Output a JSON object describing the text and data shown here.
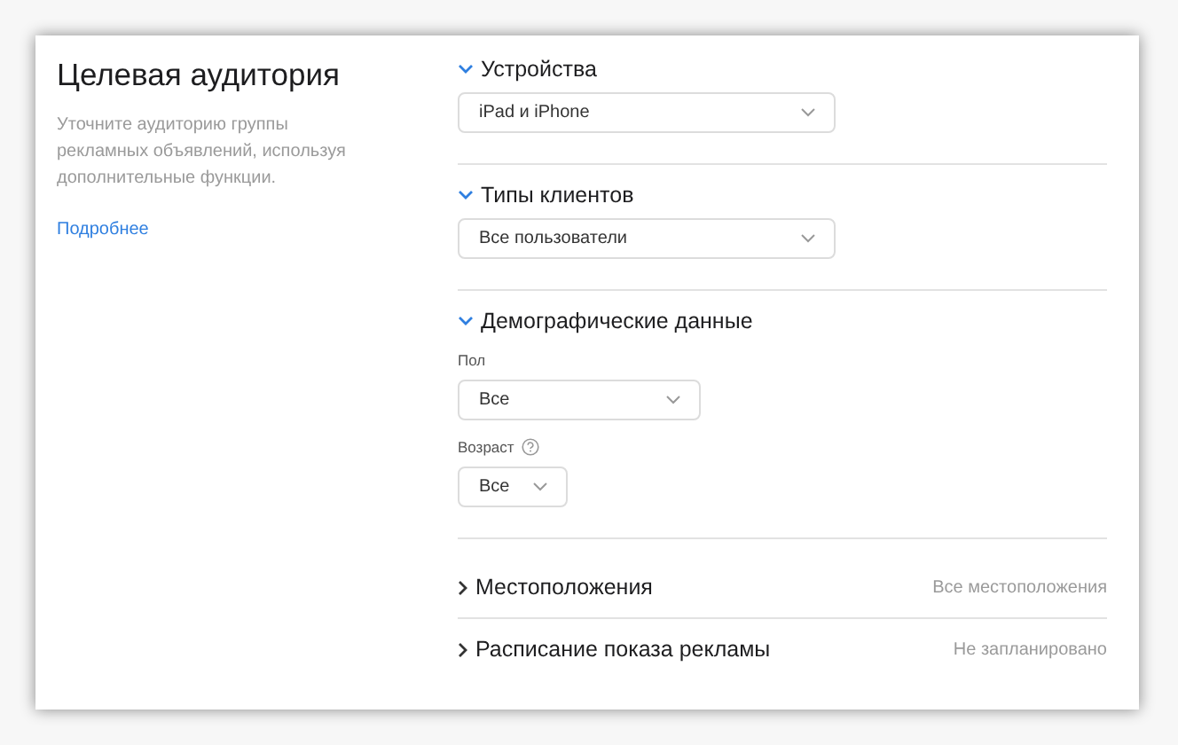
{
  "intro": {
    "title": "Целевая аудитория",
    "description": "Уточните аудиторию группы рекламных объявлений, используя дополнительные функции.",
    "link": "Подробнее"
  },
  "sections": [
    {
      "title": "Устройства",
      "expanded": true,
      "fields": [
        {
          "value": "iPad и iPhone",
          "kind": "wide"
        }
      ]
    },
    {
      "title": "Типы клиентов",
      "expanded": true,
      "fields": [
        {
          "value": "Все пользователи",
          "kind": "wide"
        }
      ]
    },
    {
      "title": "Демографические данные",
      "expanded": true,
      "fields": [
        {
          "label": "Пол",
          "value": "Все",
          "kind": "medium",
          "help": false
        },
        {
          "label": "Возраст",
          "value": "Все",
          "kind": "narrow",
          "help": true
        }
      ]
    },
    {
      "title": "Местоположения",
      "expanded": false,
      "summary": "Все местоположения"
    },
    {
      "title": "Расписание показа рекламы",
      "expanded": false,
      "summary": "Не запланировано"
    }
  ]
}
